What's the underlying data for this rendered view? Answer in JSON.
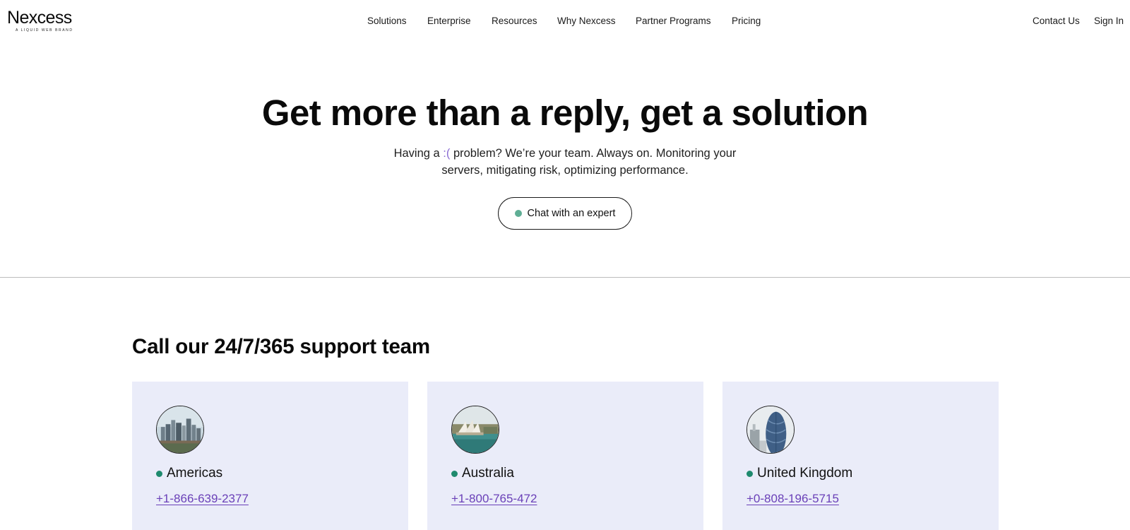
{
  "brand": {
    "name": "Nexcess",
    "tagline": "A LIQUID WEB BRAND"
  },
  "nav": {
    "items": [
      "Solutions",
      "Enterprise",
      "Resources",
      "Why Nexcess",
      "Partner Programs",
      "Pricing"
    ],
    "contact": "Contact Us",
    "signin": "Sign In"
  },
  "hero": {
    "title": "Get more than a reply, get a solution",
    "subtitle_before": "Having a ",
    "subtitle_frown": ":(",
    "subtitle_after": " problem? We’re your team. Always on. Monitoring your servers, mitigating risk, optimizing performance.",
    "cta": "Chat with an expert"
  },
  "support": {
    "title": "Call our 24/7/365 support team",
    "regions": [
      {
        "name": "Americas",
        "phone": "+1-866-639-2377",
        "image": "city-skyline-image"
      },
      {
        "name": "Australia",
        "phone": "+1-800-765-472",
        "image": "sydney-opera-house-image"
      },
      {
        "name": "United Kingdom",
        "phone": "+0-808-196-5715",
        "image": "london-gherkin-image"
      }
    ]
  },
  "colors": {
    "accent_dot": "#5fae95",
    "region_dot": "#1e8a6e",
    "card_bg": "#eaecf9",
    "link": "#6a40b8"
  }
}
